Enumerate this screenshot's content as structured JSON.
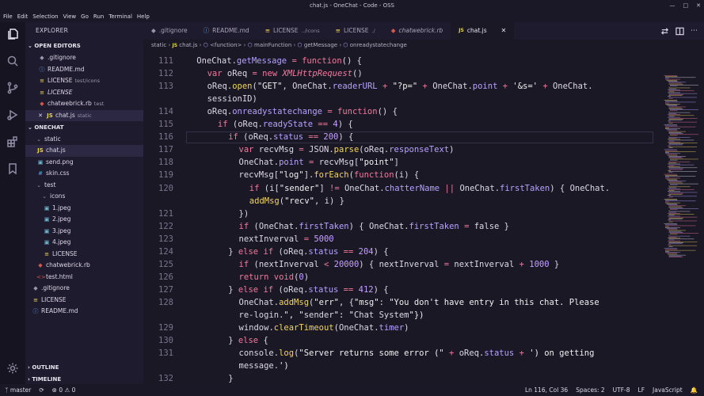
{
  "window": {
    "title": "chat.js - OneChat - Code - OSS"
  },
  "menu": [
    "File",
    "Edit",
    "Selection",
    "View",
    "Go",
    "Run",
    "Terminal",
    "Help"
  ],
  "sidebar": {
    "header": "EXPLORER",
    "open_editors_title": "OPEN EDITORS",
    "open_editors": [
      {
        "name": ".gitignore",
        "desc": ""
      },
      {
        "name": "README.md",
        "desc": ""
      },
      {
        "name": "LICENSE",
        "desc": "test/icons"
      },
      {
        "name": "LICENSE",
        "desc": ""
      },
      {
        "name": "chatwebrick.rb",
        "desc": "test"
      },
      {
        "name": "chat.js",
        "desc": "static"
      }
    ],
    "project_title": "ONECHAT",
    "tree": [
      {
        "name": "static",
        "icon": "chevron-down",
        "depth": 1
      },
      {
        "name": "chat.js",
        "icon": "js",
        "depth": 2
      },
      {
        "name": "send.png",
        "icon": "image",
        "depth": 2
      },
      {
        "name": "skin.css",
        "icon": "css",
        "depth": 2
      },
      {
        "name": "test",
        "icon": "chevron-down",
        "depth": 1
      },
      {
        "name": "icons",
        "icon": "chevron-down",
        "depth": 2
      },
      {
        "name": "1.jpeg",
        "icon": "image",
        "depth": 3
      },
      {
        "name": "2.jpeg",
        "icon": "image",
        "depth": 3
      },
      {
        "name": "3.jpeg",
        "icon": "image",
        "depth": 3
      },
      {
        "name": "4.jpeg",
        "icon": "image",
        "depth": 3
      },
      {
        "name": "LICENSE",
        "icon": "license",
        "depth": 3
      },
      {
        "name": "chatwebrick.rb",
        "icon": "ruby",
        "depth": 2
      },
      {
        "name": "test.html",
        "icon": "html",
        "depth": 2
      },
      {
        "name": ".gitignore",
        "icon": "git",
        "depth": 1
      },
      {
        "name": "LICENSE",
        "icon": "license",
        "depth": 1
      },
      {
        "name": "README.md",
        "icon": "info",
        "depth": 1
      }
    ],
    "outline_title": "OUTLINE",
    "timeline_title": "TIMELINE"
  },
  "tabs": [
    {
      "name": ".gitignore",
      "desc": ""
    },
    {
      "name": "README.md",
      "desc": ""
    },
    {
      "name": "LICENSE",
      "desc": "../icons"
    },
    {
      "name": "LICENSE",
      "desc": "./"
    },
    {
      "name": "chatwebrick.rb",
      "desc": ""
    },
    {
      "name": "chat.js",
      "desc": ""
    }
  ],
  "breadcrumbs": [
    "static",
    "chat.js",
    "<function>",
    "mainFunction",
    "getMessage",
    "onreadystatechange"
  ],
  "code": {
    "lines": [
      {
        "num": "111",
        "text": "OneChat.getMessage = function() {",
        "indent": 1
      },
      {
        "num": "112",
        "text": "var oReq = new XMLHttpRequest()",
        "indent": 2
      },
      {
        "num": "113",
        "text": "oReq.open(\"GET\", OneChat.readerURL + \"?p=\" + OneChat.point + '&s=' + OneChat.",
        "indent": 2
      },
      {
        "num": "",
        "text": "sessionID)",
        "indent": 2
      },
      {
        "num": "114",
        "text": "oReq.onreadystatechange = function() {",
        "indent": 2
      },
      {
        "num": "115",
        "text": "if (oReq.readyState == 4) {",
        "indent": 3
      },
      {
        "num": "116",
        "text": "if (oReq.status == 200) {",
        "indent": 4
      },
      {
        "num": "117",
        "text": "var recvMsg = JSON.parse(oReq.responseText)",
        "indent": 5
      },
      {
        "num": "118",
        "text": "OneChat.point = recvMsg[\"point\"]",
        "indent": 5
      },
      {
        "num": "119",
        "text": "recvMsg[\"log\"].forEach(function(i) {",
        "indent": 5
      },
      {
        "num": "120",
        "text": "if (i[\"sender\"] != OneChat.chatterName || OneChat.firstTaken) { OneChat.",
        "indent": 6
      },
      {
        "num": "",
        "text": "addMsg(\"recv\", i) }",
        "indent": 6
      },
      {
        "num": "121",
        "text": "})",
        "indent": 5
      },
      {
        "num": "122",
        "text": "if (OneChat.firstTaken) { OneChat.firstTaken = false }",
        "indent": 5
      },
      {
        "num": "123",
        "text": "nextInverval = 5000",
        "indent": 5
      },
      {
        "num": "124",
        "text": "} else if (oReq.status == 204) {",
        "indent": 4
      },
      {
        "num": "125",
        "text": "if (nextInverval < 20000) { nextInverval = nextInverval + 1000 }",
        "indent": 5
      },
      {
        "num": "126",
        "text": "return void(0)",
        "indent": 5
      },
      {
        "num": "127",
        "text": "} else if (oReq.status == 412) {",
        "indent": 4
      },
      {
        "num": "128",
        "text": "OneChat.addMsg(\"err\", {\"msg\": \"You don't have entry in this chat. Please",
        "indent": 5
      },
      {
        "num": "",
        "text": "re-login.\", \"sender\": \"Chat System\"})",
        "indent": 5
      },
      {
        "num": "129",
        "text": "window.clearTimeout(OneChat.timer)",
        "indent": 5
      },
      {
        "num": "130",
        "text": "} else {",
        "indent": 4
      },
      {
        "num": "131",
        "text": "console.log(\"Server returns some error (\" + oReq.status + ') on getting",
        "indent": 5
      },
      {
        "num": "",
        "text": "message.')",
        "indent": 5
      },
      {
        "num": "132",
        "text": "}",
        "indent": 4
      }
    ]
  },
  "status": {
    "branch": "master",
    "errors": "0",
    "warnings": "0",
    "position": "Ln 116, Col 36",
    "spaces": "Spaces: 2",
    "encoding": "UTF-8",
    "eol": "LF",
    "language": "JavaScript"
  },
  "colors": {
    "accent": "#f07a9c",
    "string": "#f0f0f0",
    "function": "#f2d65a",
    "number": "#c3a0ff"
  }
}
